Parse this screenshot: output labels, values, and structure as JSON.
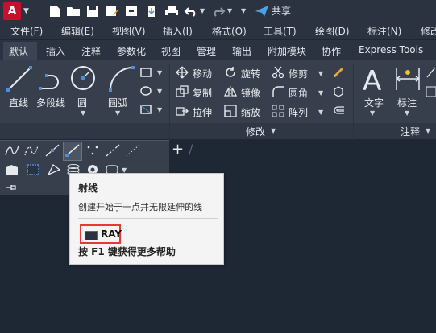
{
  "app": {
    "logo_letter": "A"
  },
  "quick_access": {
    "share_label": "共享"
  },
  "menus": [
    "文件(F)",
    "编辑(E)",
    "视图(V)",
    "插入(I)",
    "格式(O)",
    "工具(T)",
    "绘图(D)",
    "标注(N)",
    "修改"
  ],
  "tabs": [
    "默认",
    "插入",
    "注释",
    "参数化",
    "视图",
    "管理",
    "输出",
    "附加模块",
    "协作",
    "Express Tools"
  ],
  "draw": {
    "line": "直线",
    "polyline": "多段线",
    "circle": "圆",
    "arc": "圆弧"
  },
  "modify": {
    "move": "移动",
    "rotate": "旋转",
    "trim": "修剪",
    "copy": "复制",
    "mirror": "镜像",
    "fillet": "圆角",
    "stretch": "拉伸",
    "scale": "缩放",
    "array": "阵列",
    "panel_label": "修改"
  },
  "annotation": {
    "text": "文字",
    "dimension": "标注",
    "panel_label": "注释"
  },
  "tooltip": {
    "title": "射线",
    "description": "创建开始于一点并无限延伸的线",
    "command": "RAY",
    "help": "按 F1 键获得更多帮助"
  },
  "colors": {
    "accent": "#4a90d9",
    "highlight_box": "#e53935",
    "background": "#1e2734"
  }
}
